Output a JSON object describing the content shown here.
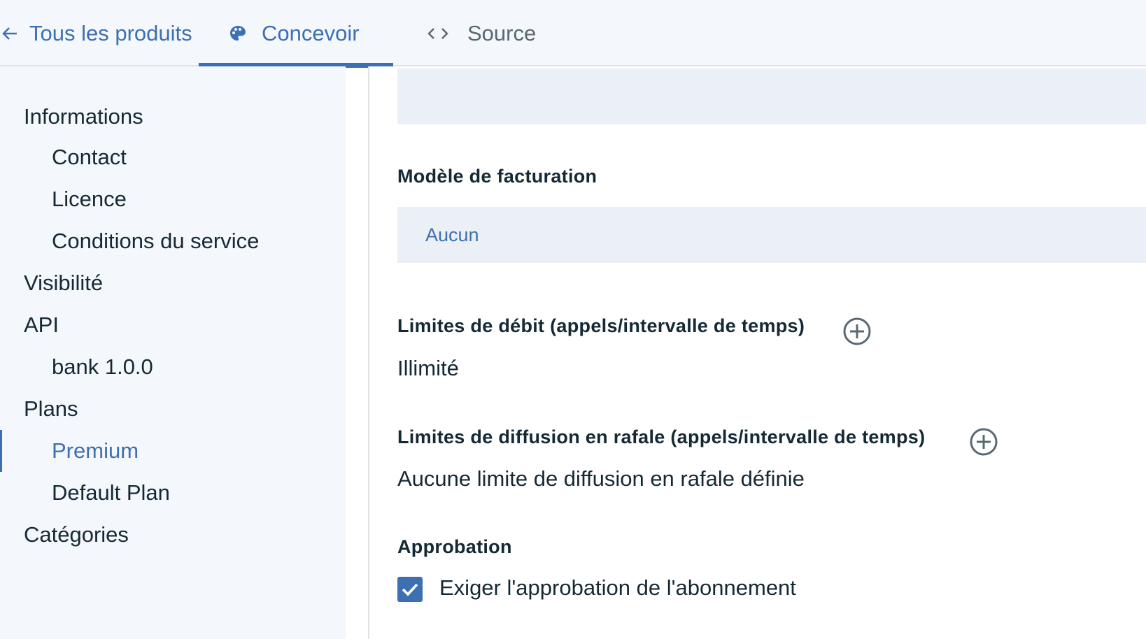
{
  "tabs": {
    "back_label": "Tous les produits",
    "design_label": "Concevoir",
    "source_label": "Source"
  },
  "sidebar": {
    "items": [
      {
        "label": "Informations",
        "level": 1
      },
      {
        "label": "Contact",
        "level": 2
      },
      {
        "label": "Licence",
        "level": 2
      },
      {
        "label": "Conditions du service",
        "level": 2
      },
      {
        "label": "Visibilité",
        "level": 1
      },
      {
        "label": "API",
        "level": 1
      },
      {
        "label": "bank 1.0.0",
        "level": 2
      },
      {
        "label": "Plans",
        "level": 1
      },
      {
        "label": "Premium",
        "level": 2,
        "active": true
      },
      {
        "label": "Default Plan",
        "level": 2
      },
      {
        "label": "Catégories",
        "level": 1
      }
    ]
  },
  "main": {
    "billing_label": "Modèle de facturation",
    "billing_value": "Aucun",
    "rate_limits_label": "Limites de débit (appels/intervalle de temps)",
    "rate_limits_value": "Illimité",
    "burst_limits_label": "Limites de diffusion en rafale (appels/intervalle de temps)",
    "burst_limits_value": "Aucune limite de diffusion en rafale définie",
    "approval_label": "Approbation",
    "approval_checkbox_label": "Exiger l'approbation de l'abonnement",
    "approval_checked": true
  },
  "colors": {
    "accent": "#3d70b2",
    "sidebar_bg": "#f4f7fb",
    "input_bg": "#ebf0f7",
    "text": "#152935"
  }
}
